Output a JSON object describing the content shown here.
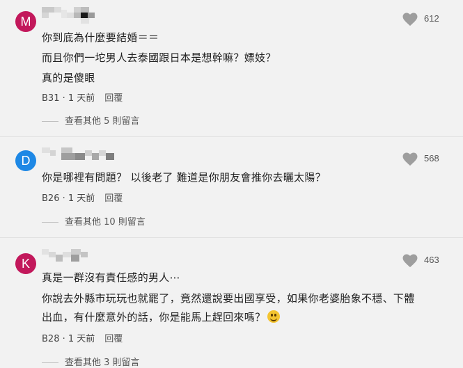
{
  "comments": [
    {
      "avatar_letter": "M",
      "avatar_color": "#c2185b",
      "lines": [
        "你到底為什麼要結婚＝＝",
        "而且你們一坨男人去泰國跟日本是想幹嘛？嫖妓？",
        "真的是傻眼"
      ],
      "floor": "B31",
      "time": "1 天前",
      "reply_label": "回覆",
      "likes": "612",
      "more_replies": "查看其他 5 則留言"
    },
    {
      "avatar_letter": "D",
      "avatar_color": "#1e88e5",
      "lines": [
        "你是哪裡有問題？ 以後老了 難道是你朋友會推你去曬太陽？"
      ],
      "floor": "B26",
      "time": "1 天前",
      "reply_label": "回覆",
      "likes": "568",
      "more_replies": "查看其他 10 則留言"
    },
    {
      "avatar_letter": "K",
      "avatar_color": "#c2185b",
      "lines": [
        "真是一群沒有責任感的男人⋯",
        "你說去外縣市玩玩也就罷了，竟然還說要出國享受，如果你老婆胎象不穩、下體",
        "出血，有什麼意外的話，你是能馬上趕回來嗎？"
      ],
      "floor": "B28",
      "time": "1 天前",
      "reply_label": "回覆",
      "likes": "463",
      "more_replies": "查看其他 3 則留言"
    }
  ],
  "colors": {
    "background": "#f2f2f2",
    "text": "#222222",
    "muted": "#555555",
    "heart": "#9e9e9e"
  },
  "icons": {
    "like": "heart-icon",
    "emoji": "grinning-face-icon"
  }
}
